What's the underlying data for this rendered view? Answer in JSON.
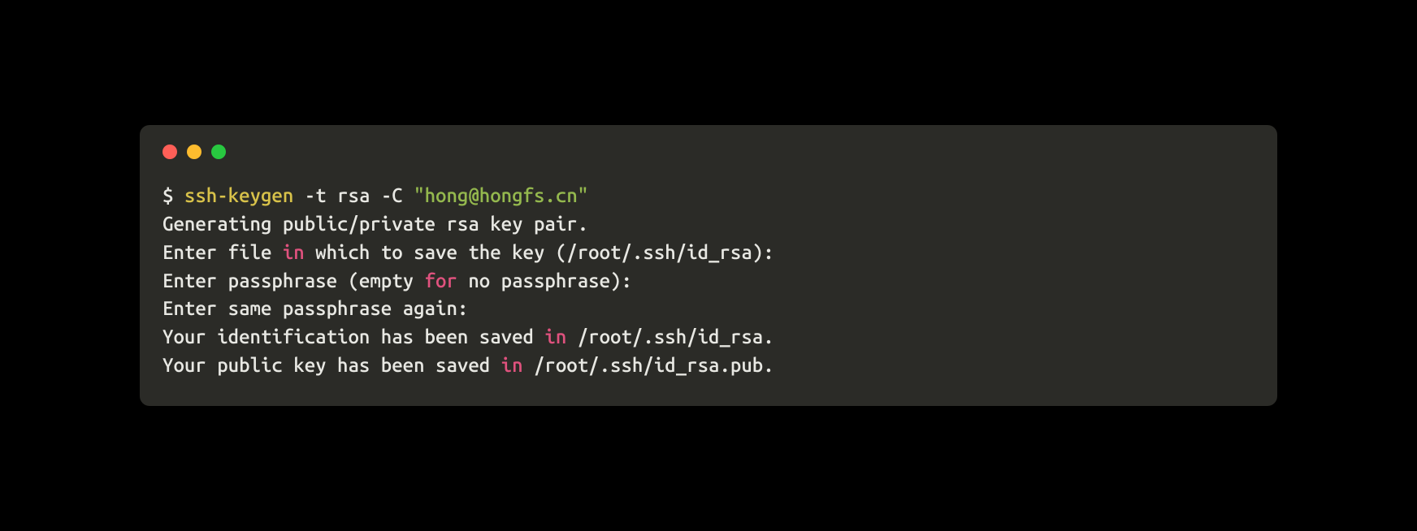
{
  "colors": {
    "background": "#000000",
    "terminal_bg": "#2b2b27",
    "close": "#ff5f57",
    "minimize": "#febc2e",
    "maximize": "#28c840",
    "text": "#e8e8e3",
    "command": "#d8c24a",
    "string": "#94b84e",
    "keyword": "#e0527e"
  },
  "terminal": {
    "prompt": "$ ",
    "command": {
      "name": "ssh-keygen",
      "flag1": " -t ",
      "arg1": "rsa",
      "flag2": " -C ",
      "string": "\"hong@hongfs.cn\""
    },
    "output": {
      "line1": "Generating public/private rsa key pair.",
      "line2_a": "Enter file ",
      "line2_kw": "in",
      "line2_b": " which to save the key (/root/.ssh/id_rsa):",
      "line3_a": "Enter passphrase (empty ",
      "line3_kw": "for",
      "line3_b": " no passphrase):",
      "line4": "Enter same passphrase again:",
      "line5_a": "Your identification has been saved ",
      "line5_kw": "in",
      "line5_b": " /root/.ssh/id_rsa.",
      "line6_a": "Your public key has been saved ",
      "line6_kw": "in",
      "line6_b": " /root/.ssh/id_rsa.pub."
    }
  }
}
